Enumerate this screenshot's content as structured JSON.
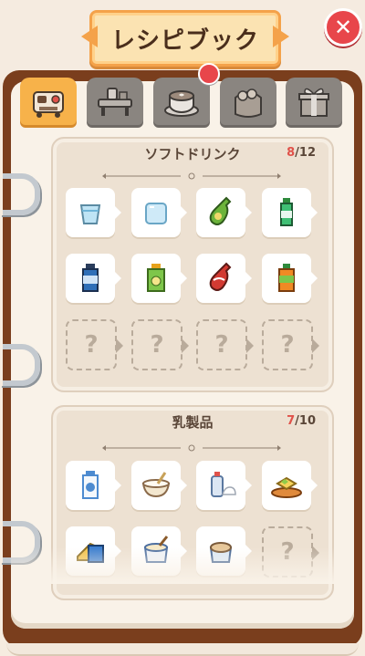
{
  "header": {
    "title": "レシピブック"
  },
  "close": {
    "icon": "close-icon",
    "glyph": "✕"
  },
  "tabs": [
    {
      "name": "tab-machine",
      "icon": "coffee-machine-icon",
      "active": true
    },
    {
      "name": "tab-workbench",
      "icon": "workbench-icon",
      "active": false
    },
    {
      "name": "tab-latte",
      "icon": "latte-icon",
      "active": false
    },
    {
      "name": "tab-bread",
      "icon": "bread-bag-icon",
      "active": false
    },
    {
      "name": "tab-gift",
      "icon": "gift-icon",
      "active": false
    }
  ],
  "sections": [
    {
      "title": "ソフトドリンク",
      "count_have": "8",
      "count_total": "/12",
      "items": [
        "water-glass-icon",
        "ice-cube-icon",
        "green-bottle-icon",
        "soda-bottle-icon",
        "blue-bottle-icon",
        "lime-juice-icon",
        "cola-bottle-icon",
        "orange-soda-icon",
        "locked",
        "locked",
        "locked",
        "locked"
      ]
    },
    {
      "title": "乳製品",
      "count_have": "7",
      "count_total": "/10",
      "items": [
        "milk-bottle-icon",
        "yogurt-bowl-icon",
        "whipped-cream-icon",
        "butter-plate-icon",
        "cheese-icon",
        "cream-tub-icon",
        "ice-cream-cup-icon",
        "locked"
      ]
    }
  ],
  "locked_glyph": "?"
}
